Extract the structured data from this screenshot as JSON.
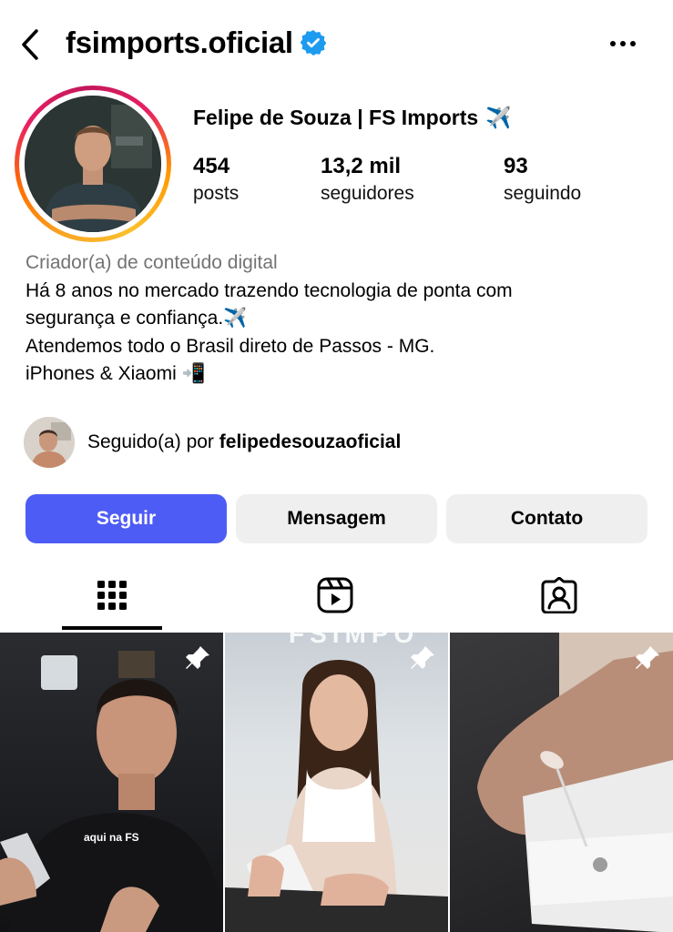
{
  "header": {
    "username": "fsimports.oficial"
  },
  "profile": {
    "display_name": "Felipe de Souza | FS Imports",
    "name_emoji": "✈️",
    "stats": [
      {
        "value": "454",
        "label": "posts"
      },
      {
        "value": "13,2 mil",
        "label": "seguidores"
      },
      {
        "value": "93",
        "label": "seguindo"
      }
    ]
  },
  "bio": {
    "category": "Criador(a) de conteúdo digital",
    "lines": [
      "Há 8 anos no mercado trazendo tecnologia de ponta com",
      "segurança e confiança.✈️",
      "Atendemos todo o Brasil direto de Passos - MG.",
      "iPhones & Xiaomi 📲"
    ]
  },
  "followed_by": {
    "prefix": "Seguido(a) por ",
    "user": "felipedesouzaoficial"
  },
  "actions": {
    "follow": "Seguir",
    "message": "Mensagem",
    "contact": "Contato"
  },
  "tabs": [
    "grid-icon",
    "reels-icon",
    "tagged-icon"
  ],
  "grid": {
    "posts": [
      {
        "caption": "aqui na FS",
        "pinned": true
      },
      {
        "overlay": "FSIMPO",
        "pinned": true
      },
      {
        "pinned": true
      }
    ]
  },
  "colors": {
    "primary_button": "#4e5cf6",
    "secondary_button": "#efeff0",
    "verified": "#1d9bf0",
    "muted_text": "#737373"
  }
}
